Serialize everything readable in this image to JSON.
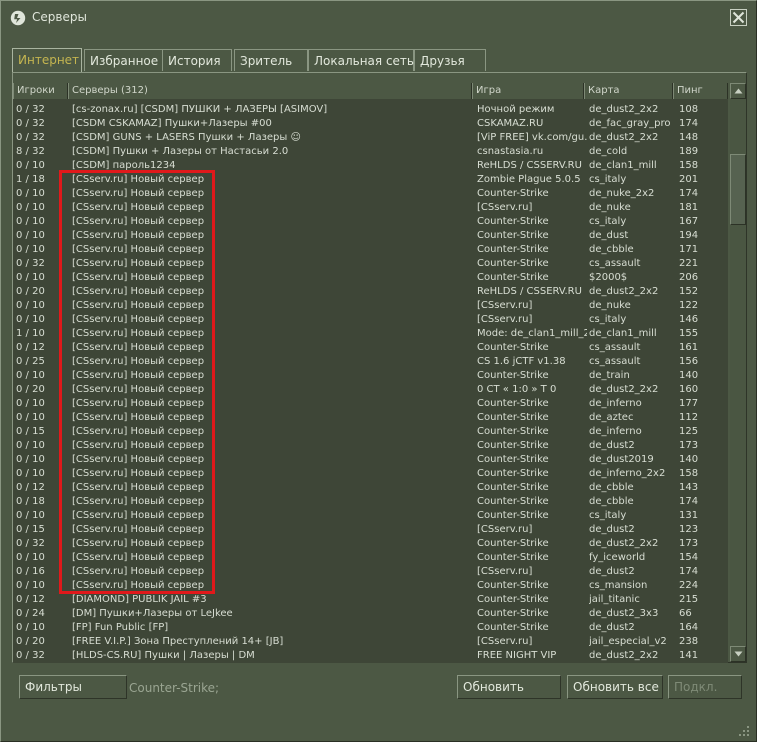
{
  "window": {
    "title": "Серверы",
    "colors": {
      "background": "#4c5844",
      "list_bg": "#3e4637",
      "active_tab_text": "#c4b550",
      "highlight_box": "#e0191b"
    }
  },
  "tabs": [
    {
      "label": "Интернет",
      "active": true
    },
    {
      "label": "Избранное",
      "active": false
    },
    {
      "label": "История",
      "active": false
    },
    {
      "label": "Зритель",
      "active": false
    },
    {
      "label": "Локальная сеть",
      "active": false
    },
    {
      "label": "Друзья",
      "active": false
    }
  ],
  "columns": {
    "players": "Игроки",
    "servers": "Серверы (312)",
    "game": "Игра",
    "map": "Карта",
    "ping": "Пинг"
  },
  "servers": [
    {
      "players": "0 / 32",
      "name": "[cs-zonax.ru] [CSDM] ПУШКИ + ЛАЗЕРЫ [ASIMOV]",
      "game": "Ночной режим",
      "map": "de_dust2_2x2",
      "ping": "108"
    },
    {
      "players": "0 / 32",
      "name": "[CSDM CSKAMAZ] Пушки+Лазеры #00",
      "game": "CSKAMAZ.RU",
      "map": "de_fac_gray_pro",
      "ping": "174"
    },
    {
      "players": "0 / 32",
      "name": "[CSDM] GUNS + LASERS Пушки + Лазеры ☺",
      "game": "[ViP FREE] vk.com/gu...",
      "map": "de_dust2_2x2",
      "ping": "148"
    },
    {
      "players": "8 / 32",
      "name": "[CSDM] Пушки + Лазеры от Настасьи 2.0",
      "game": "csnastasia.ru",
      "map": "de_cold",
      "ping": "189"
    },
    {
      "players": "0 / 10",
      "name": "[CSDM] пароль1234",
      "game": "ReHLDS / CSSERV.RU",
      "map": "de_clan1_mill",
      "ping": "158"
    },
    {
      "players": "1 / 18",
      "name": "[CSserv.ru] Новый сервер",
      "game": "Zombie Plague 5.0.5",
      "map": "cs_italy",
      "ping": "201"
    },
    {
      "players": "0 / 10",
      "name": "[CSserv.ru] Новый сервер",
      "game": "Counter-Strike",
      "map": "de_nuke_2x2",
      "ping": "174"
    },
    {
      "players": "0 / 10",
      "name": "[CSserv.ru] Новый сервер",
      "game": "[CSserv.ru]",
      "map": "de_nuke",
      "ping": "181"
    },
    {
      "players": "0 / 10",
      "name": "[CSserv.ru] Новый сервер",
      "game": "Counter-Strike",
      "map": "cs_italy",
      "ping": "167"
    },
    {
      "players": "0 / 10",
      "name": "[CSserv.ru] Новый сервер",
      "game": "Counter-Strike",
      "map": "de_dust",
      "ping": "194"
    },
    {
      "players": "0 / 10",
      "name": "[CSserv.ru] Новый сервер",
      "game": "Counter-Strike",
      "map": "de_cbble",
      "ping": "171"
    },
    {
      "players": "0 / 32",
      "name": "[CSserv.ru] Новый сервер",
      "game": "Counter-Strike",
      "map": "cs_assault",
      "ping": "221"
    },
    {
      "players": "0 / 10",
      "name": "[CSserv.ru] Новый сервер",
      "game": "Counter-Strike",
      "map": "$2000$",
      "ping": "206"
    },
    {
      "players": "0 / 20",
      "name": "[CSserv.ru] Новый сервер",
      "game": "ReHLDS / CSSERV.RU",
      "map": "de_dust2_2x2",
      "ping": "152"
    },
    {
      "players": "0 / 10",
      "name": "[CSserv.ru] Новый сервер",
      "game": "[CSserv.ru]",
      "map": "de_nuke",
      "ping": "122"
    },
    {
      "players": "0 / 10",
      "name": "[CSserv.ru] Новый сервер",
      "game": "[CSserv.ru]",
      "map": "cs_italy",
      "ping": "146"
    },
    {
      "players": "1 / 10",
      "name": "[CSserv.ru] Новый сервер",
      "game": "Mode: de_clan1_mill_2x2",
      "map": "de_clan1_mill",
      "ping": "155"
    },
    {
      "players": "0 / 12",
      "name": "[CSserv.ru] Новый сервер",
      "game": "Counter-Strike",
      "map": "cs_assault",
      "ping": "161"
    },
    {
      "players": "0 / 25",
      "name": "[CSserv.ru] Новый сервер",
      "game": "CS 1.6 jCTF v1.38",
      "map": "cs_assault",
      "ping": "156"
    },
    {
      "players": "0 / 10",
      "name": "[CSserv.ru] Новый сервер",
      "game": "Counter-Strike",
      "map": "de_train",
      "ping": "140"
    },
    {
      "players": "0 / 20",
      "name": "[CSserv.ru] Новый сервер",
      "game": "0 CT « 1:0 » T 0",
      "map": "de_dust2_2x2",
      "ping": "160"
    },
    {
      "players": "0 / 10",
      "name": "[CSserv.ru] Новый сервер",
      "game": "Counter-Strike",
      "map": "de_inferno",
      "ping": "177"
    },
    {
      "players": "0 / 10",
      "name": "[CSserv.ru] Новый сервер",
      "game": "Counter-Strike",
      "map": "de_aztec",
      "ping": "112"
    },
    {
      "players": "0 / 15",
      "name": "[CSserv.ru] Новый сервер",
      "game": "Counter-Strike",
      "map": "de_inferno",
      "ping": "125"
    },
    {
      "players": "0 / 10",
      "name": "[CSserv.ru] Новый сервер",
      "game": "Counter-Strike",
      "map": "de_dust2",
      "ping": "173"
    },
    {
      "players": "0 / 10",
      "name": "[CSserv.ru] Новый сервер",
      "game": "Counter-Strike",
      "map": "de_dust2019",
      "ping": "140"
    },
    {
      "players": "0 / 10",
      "name": "[CSserv.ru] Новый сервер",
      "game": "Counter-Strike",
      "map": "de_inferno_2x2",
      "ping": "158"
    },
    {
      "players": "0 / 12",
      "name": "[CSserv.ru] Новый сервер",
      "game": "Counter-Strike",
      "map": "de_cbble",
      "ping": "143"
    },
    {
      "players": "0 / 18",
      "name": "[CSserv.ru] Новый сервер",
      "game": "Counter-Strike",
      "map": "de_cbble",
      "ping": "174"
    },
    {
      "players": "0 / 10",
      "name": "[CSserv.ru] Новый сервер",
      "game": "Counter-Strike",
      "map": "cs_italy",
      "ping": "131"
    },
    {
      "players": "0 / 15",
      "name": "[CSserv.ru] Новый сервер",
      "game": "[CSserv.ru]",
      "map": "de_dust2",
      "ping": "123"
    },
    {
      "players": "0 / 32",
      "name": "[CSserv.ru] Новый сервер",
      "game": "Counter-Strike",
      "map": "de_dust2_2x2",
      "ping": "173"
    },
    {
      "players": "0 / 10",
      "name": "[CSserv.ru] Новый сервер",
      "game": "Counter-Strike",
      "map": "fy_iceworld",
      "ping": "154"
    },
    {
      "players": "0 / 16",
      "name": "[CSserv.ru] Новый сервер",
      "game": "[CSserv.ru]",
      "map": "de_dust2",
      "ping": "174"
    },
    {
      "players": "0 / 10",
      "name": "[CSserv.ru] Новый сервер",
      "game": "Counter-Strike",
      "map": "cs_mansion",
      "ping": "224"
    },
    {
      "players": "0 / 12",
      "name": "[DIAMOND] PUBLIK JAIL #3",
      "game": "Counter-Strike",
      "map": "jail_titanic",
      "ping": "215"
    },
    {
      "players": "0 / 24",
      "name": "[DM] Пушки+Лазеры от LeJkee",
      "game": "Counter-Strike",
      "map": "de_dust2_3x3",
      "ping": "66"
    },
    {
      "players": "0 / 10",
      "name": "[FP] Fun Public [FP]",
      "game": "Counter-Strike",
      "map": "de_dust2",
      "ping": "164"
    },
    {
      "players": "0 / 20",
      "name": "[FREE V.I.P.] Зона Преступлений 14+ [JB]",
      "game": "[CSserv.ru]",
      "map": "jail_especial_v2",
      "ping": "238"
    },
    {
      "players": "0 / 32",
      "name": "[HLDS-CS.RU] Пушки | Лазеры | DM",
      "game": "FREE NIGHT VIP",
      "map": "de_dust2_2x2",
      "ping": "141"
    }
  ],
  "footer": {
    "filters_label": "Фильтры",
    "filter_description": "Counter-Strike;",
    "refresh_label": "Обновить",
    "refresh_all_label": "Обновить все",
    "connect_label": "Подкл."
  }
}
